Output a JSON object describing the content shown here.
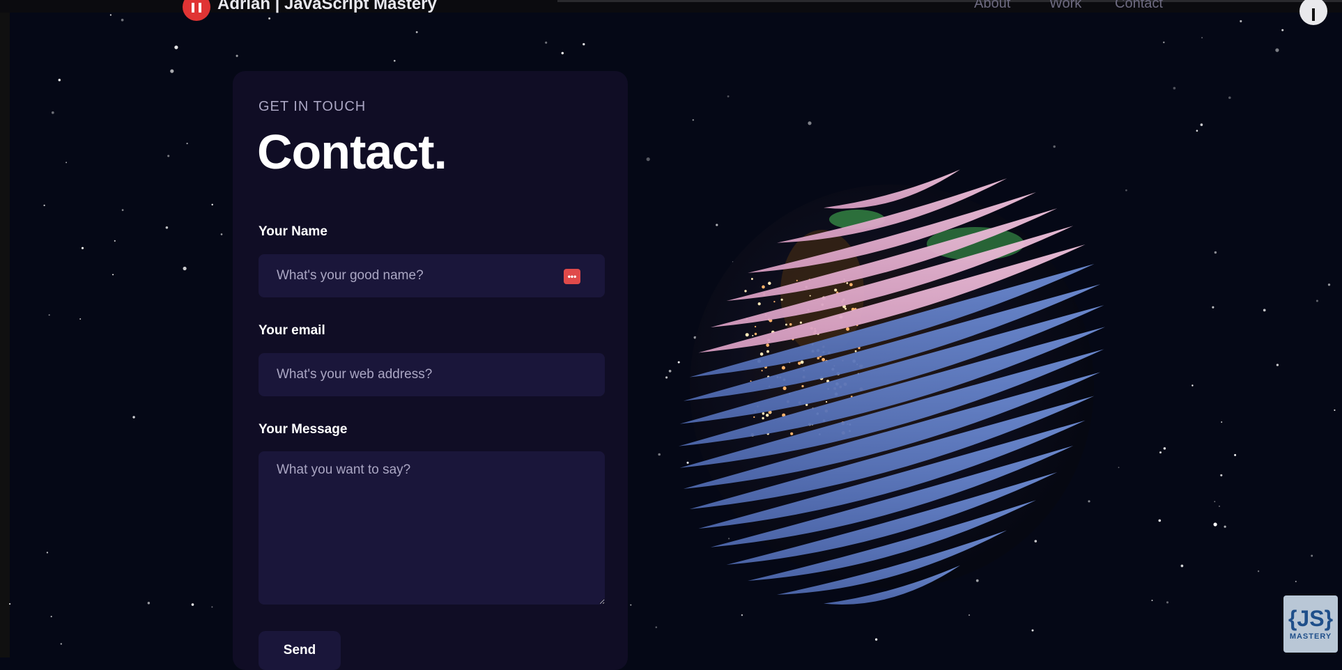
{
  "nav": {
    "brand": "Adrian | JavaScript Mastery",
    "links": [
      "About",
      "Work",
      "Contact"
    ]
  },
  "contact": {
    "eyebrow": "GET IN TOUCH",
    "title": "Contact.",
    "name_label": "Your Name",
    "name_placeholder": "What's your good name?",
    "email_label": "Your email",
    "email_placeholder": "What's your web address?",
    "message_label": "Your Message",
    "message_placeholder": "What you want to say?",
    "send_label": "Send",
    "autofill_badge": "•••"
  },
  "watermark": {
    "logo": "{JS}",
    "text": "MASTERY"
  },
  "colors": {
    "background": "#050816",
    "card": "#100d25",
    "input": "#1a163a",
    "secondary_text": "#aaa6c3"
  },
  "icons": [
    "logo-icon",
    "menu-icon",
    "autofill-icon",
    "globe-model"
  ]
}
